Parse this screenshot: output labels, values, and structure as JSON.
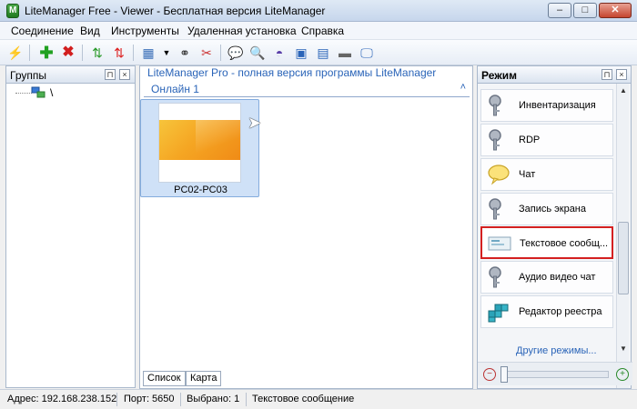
{
  "window": {
    "title": "LiteManager Free - Viewer - Бесплатная версия LiteManager",
    "minimize": "–",
    "maximize": "□",
    "close": "✕"
  },
  "menu": [
    "Соединение",
    "Вид",
    "Инструменты",
    "Удаленная установка",
    "Справка"
  ],
  "toolbar": {
    "icons": [
      "lightning-icon",
      "add-icon",
      "delete-icon",
      "refresh-icon",
      "refresh-alt-icon",
      "view-grid-icon",
      "dropdown-icon",
      "binoculars-icon",
      "tools-icon",
      "chat-icon",
      "search-icon",
      "dome-icon",
      "window-icon",
      "image-icon",
      "display-icon",
      "monitor-icon"
    ]
  },
  "groups_panel": {
    "title": "Группы",
    "tree_root": "\\"
  },
  "main": {
    "banner": "LiteManager Pro - полная версия программы LiteManager",
    "group_name": "Онлайн 1",
    "collapse_glyph": "˄",
    "computers": [
      {
        "name": "PC02-PC03"
      }
    ],
    "tabs": [
      "Список",
      "Карта"
    ]
  },
  "mode_panel": {
    "title": "Режим",
    "items": [
      {
        "label": "Инвентаризация",
        "icon": "key-icon",
        "selected": false
      },
      {
        "label": "RDP",
        "icon": "key-icon",
        "selected": false
      },
      {
        "label": "Чат",
        "icon": "chat-bubble-icon",
        "selected": false
      },
      {
        "label": "Запись экрана",
        "icon": "key-icon",
        "selected": false
      },
      {
        "label": "Текстовое сообщ...",
        "icon": "message-icon",
        "selected": true
      },
      {
        "label": "Аудио видео чат",
        "icon": "key-icon",
        "selected": false
      },
      {
        "label": "Редактор реестра",
        "icon": "registry-icon",
        "selected": false
      }
    ],
    "other_modes": "Другие режимы..."
  },
  "status": {
    "address": "Адрес: 192.168.238.152",
    "port": "Порт: 5650",
    "selected": "Выбрано: 1",
    "mode": "Текстовое сообщение"
  },
  "colors": {
    "accent": "#2a64b8",
    "selection_border": "#d42020",
    "card_selected": "#cfe1f7"
  }
}
